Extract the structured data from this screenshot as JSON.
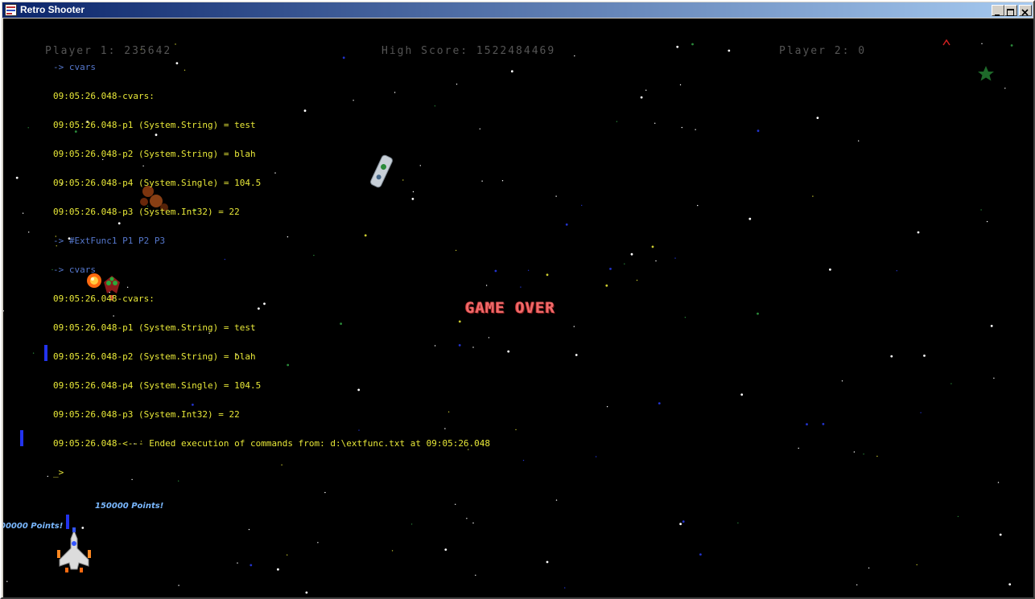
{
  "window": {
    "title": "Retro Shooter",
    "icon": "app-icon",
    "controls": [
      "minimize-icon",
      "maximize-icon",
      "close-icon"
    ]
  },
  "hud": {
    "player1": "Player 1: 235642",
    "high_score": "High Score: 1522484469",
    "player2": "Player 2: 0"
  },
  "console": {
    "lines": [
      {
        "text": "-> cvars",
        "kind": "cmd"
      },
      {
        "text": "09:05:26.048-cvars:",
        "kind": "out"
      },
      {
        "text": "09:05:26.048-p1 (System.String) = test",
        "kind": "out"
      },
      {
        "text": "09:05:26.048-p2 (System.String) = blah",
        "kind": "out"
      },
      {
        "text": "09:05:26.048-p4 (System.Single) = 104.5",
        "kind": "out"
      },
      {
        "text": "09:05:26.048-p3 (System.Int32) = 22",
        "kind": "out"
      },
      {
        "text": "-> #ExtFunc1 P1 P2 P3",
        "kind": "cmd"
      },
      {
        "text": "-> cvars",
        "kind": "cmd"
      },
      {
        "text": "09:05:26.048-cvars:",
        "kind": "out"
      },
      {
        "text": "09:05:26.048-p1 (System.String) = test",
        "kind": "out"
      },
      {
        "text": "09:05:26.048-p2 (System.String) = blah",
        "kind": "out"
      },
      {
        "text": "09:05:26.048-p4 (System.Single) = 104.5",
        "kind": "out"
      },
      {
        "text": "09:05:26.048-p3 (System.Int32) = 22",
        "kind": "out"
      },
      {
        "text": "09:05:26.048-<--- Ended execution of commands from: d:\\extfunc.txt at 09:05:26.048",
        "kind": "out"
      },
      {
        "text": "_>",
        "kind": "out"
      }
    ]
  },
  "game_over": "GAME OVER",
  "points_popups": [
    "150000 Points!",
    "00000 Points!"
  ],
  "colors": {
    "console_output": "#e8e838",
    "console_command": "#5577cc",
    "game_over": "#f06a6a",
    "points": "#7ab8ff",
    "hud": "#555555",
    "background": "#000000"
  }
}
